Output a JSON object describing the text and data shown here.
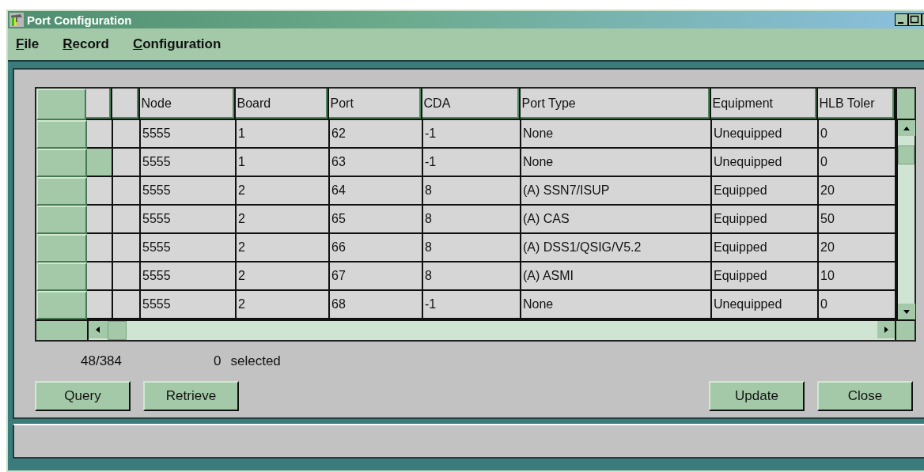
{
  "window": {
    "title": "Port Configuration"
  },
  "menu": [
    {
      "label": "File"
    },
    {
      "label": "Record"
    },
    {
      "label": "Configuration"
    }
  ],
  "table": {
    "columns": [
      "Node",
      "Board",
      "Port",
      "CDA",
      "Port Type",
      "Equipment",
      "HLB Toler"
    ],
    "rows": [
      {
        "current": false,
        "cells": [
          "5555",
          "1",
          "62",
          "-1",
          "None",
          "Unequipped",
          "0"
        ]
      },
      {
        "current": true,
        "cells": [
          "5555",
          "1",
          "63",
          "-1",
          "None",
          "Unequipped",
          "0"
        ]
      },
      {
        "current": false,
        "cells": [
          "5555",
          "2",
          "64",
          "8",
          "(A) SSN7/ISUP",
          "Equipped",
          "20"
        ]
      },
      {
        "current": false,
        "cells": [
          "5555",
          "2",
          "65",
          "8",
          "(A) CAS",
          "Equipped",
          "50"
        ]
      },
      {
        "current": false,
        "cells": [
          "5555",
          "2",
          "66",
          "8",
          "(A) DSS1/QSIG/V5.2",
          "Equipped",
          "20"
        ]
      },
      {
        "current": false,
        "cells": [
          "5555",
          "2",
          "67",
          "8",
          "(A) ASMI",
          "Equipped",
          "10"
        ]
      },
      {
        "current": false,
        "cells": [
          "5555",
          "2",
          "68",
          "-1",
          "None",
          "Unequipped",
          "0"
        ]
      }
    ]
  },
  "record_count": "48/384",
  "selected_count": "0",
  "selected_label": "selected",
  "buttons_left": [
    "Query",
    "Retrieve"
  ],
  "buttons_right": [
    "Update",
    "Close"
  ]
}
